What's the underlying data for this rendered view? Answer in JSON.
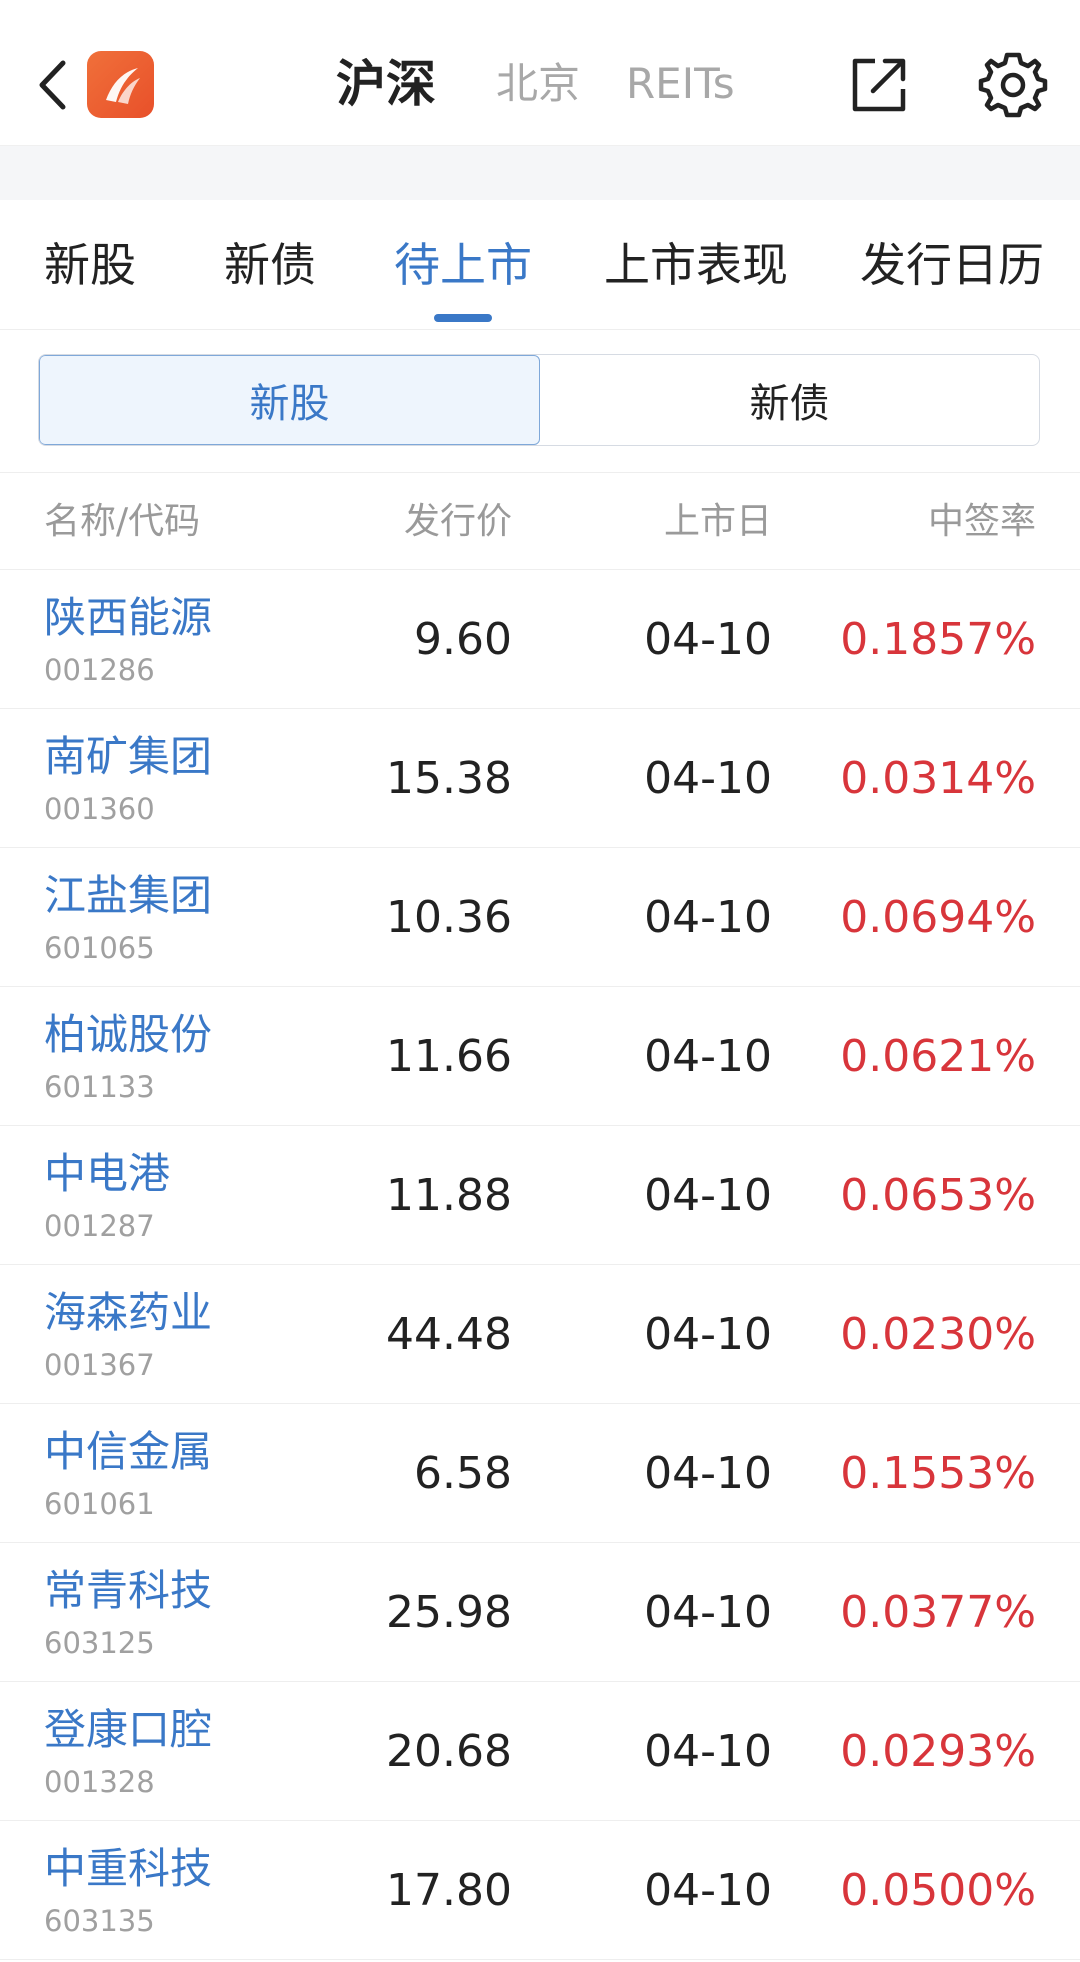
{
  "header": {
    "back_icon": "chevron-left-icon",
    "logo_icon": "app-logo-icon",
    "market_tabs": [
      {
        "label": "沪深",
        "active": true
      },
      {
        "label": "北京",
        "active": false
      },
      {
        "label": "REITs",
        "active": false
      }
    ],
    "share_icon": "share-external-icon",
    "settings_icon": "gear-icon"
  },
  "category_tabs": [
    {
      "label": "新股",
      "active": false
    },
    {
      "label": "新债",
      "active": false
    },
    {
      "label": "待上市",
      "active": true
    },
    {
      "label": "上市表现",
      "active": false
    },
    {
      "label": "发行日历",
      "active": false
    }
  ],
  "segment": [
    {
      "label": "新股",
      "active": true
    },
    {
      "label": "新债",
      "active": false
    }
  ],
  "table": {
    "columns": [
      "名称/代码",
      "发行价",
      "上市日",
      "中签率"
    ],
    "rows": [
      {
        "name": "陕西能源",
        "code": "001286",
        "price": "9.60",
        "date": "04-10",
        "rate": "0.1857%"
      },
      {
        "name": "南矿集团",
        "code": "001360",
        "price": "15.38",
        "date": "04-10",
        "rate": "0.0314%"
      },
      {
        "name": "江盐集团",
        "code": "601065",
        "price": "10.36",
        "date": "04-10",
        "rate": "0.0694%"
      },
      {
        "name": "柏诚股份",
        "code": "601133",
        "price": "11.66",
        "date": "04-10",
        "rate": "0.0621%"
      },
      {
        "name": "中电港",
        "code": "001287",
        "price": "11.88",
        "date": "04-10",
        "rate": "0.0653%"
      },
      {
        "name": "海森药业",
        "code": "001367",
        "price": "44.48",
        "date": "04-10",
        "rate": "0.0230%"
      },
      {
        "name": "中信金属",
        "code": "601061",
        "price": "6.58",
        "date": "04-10",
        "rate": "0.1553%"
      },
      {
        "name": "常青科技",
        "code": "603125",
        "price": "25.98",
        "date": "04-10",
        "rate": "0.0377%"
      },
      {
        "name": "登康口腔",
        "code": "001328",
        "price": "20.68",
        "date": "04-10",
        "rate": "0.0293%"
      },
      {
        "name": "中重科技",
        "code": "603135",
        "price": "17.80",
        "date": "04-10",
        "rate": "0.0500%"
      }
    ]
  },
  "colors": {
    "accent": "#3a78c7",
    "rate_red": "#d8353b",
    "logo_orange": "#e8502a"
  }
}
